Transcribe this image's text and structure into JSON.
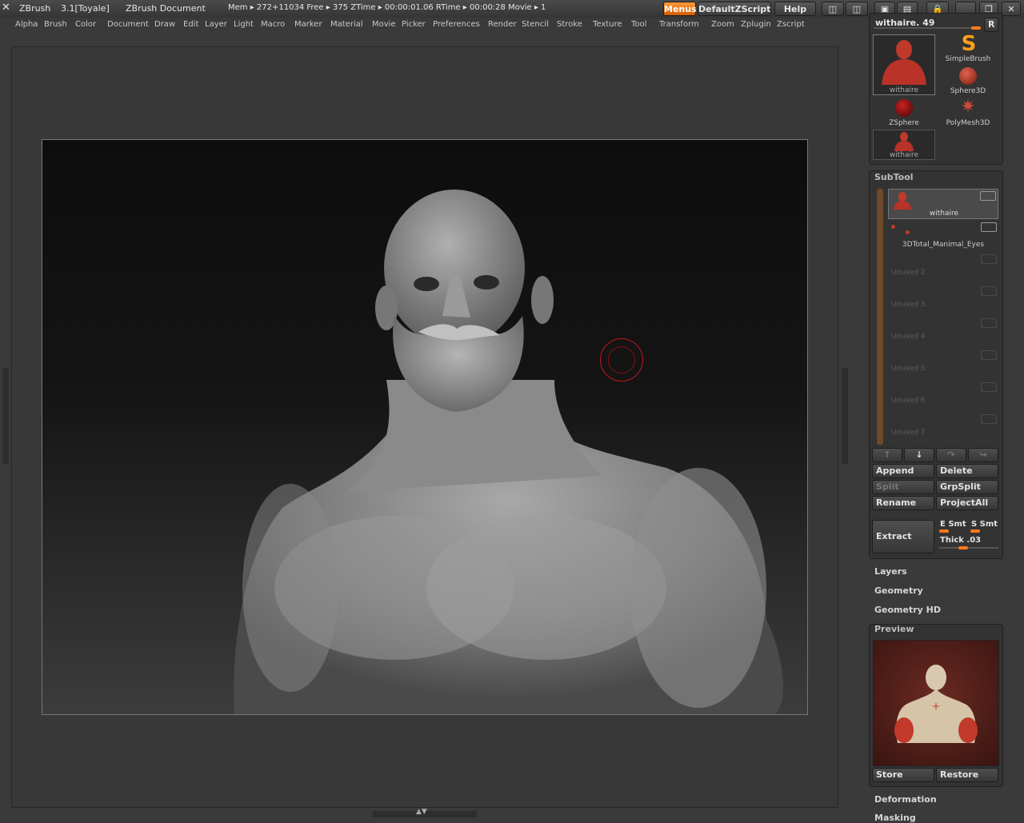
{
  "titlebar": {
    "app": "ZBrush",
    "version": "3.1[Toyale]",
    "document": "ZBrush Document",
    "stats": "Mem ▸ 272+11034  Free ▸ 375  ZTime ▸ 00:00:01.06  RTime ▸ 00:00:28  Movie ▸ 1",
    "menus_btn": "Menus",
    "script_btn": "DefaultZScript",
    "help_btn": "Help"
  },
  "menu": [
    "Alpha",
    "Brush",
    "Color",
    "Document",
    "Draw",
    "Edit",
    "Layer",
    "Light",
    "Macro",
    "Marker",
    "Material",
    "Movie",
    "Picker",
    "Preferences",
    "Render",
    "Stencil",
    "Stroke",
    "Texture",
    "Tool",
    "Transform",
    "Zoom",
    "Zplugin",
    "Zscript"
  ],
  "tool": {
    "current": "withaire. 49",
    "r_button": "R",
    "items": [
      {
        "label": "withaire"
      },
      {
        "label": "SimpleBrush"
      },
      {
        "label": "Sphere3D"
      },
      {
        "label": "ZSphere"
      },
      {
        "label": "PolyMesh3D"
      },
      {
        "label": "withaire"
      }
    ]
  },
  "subtool": {
    "title": "SubTool",
    "rows": [
      {
        "label": "withaire"
      },
      {
        "label": "3DTotal_Manimal_Eyes"
      },
      {
        "label": "Unused  2"
      },
      {
        "label": "Unused  3"
      },
      {
        "label": "Unused  4"
      },
      {
        "label": "Unused  5"
      },
      {
        "label": "Unused  6"
      },
      {
        "label": "Unused  7"
      }
    ],
    "append": "Append",
    "delete": "Delete",
    "split": "Split",
    "grpsplit": "GrpSplit",
    "rename": "Rename",
    "projectall": "ProjectAll",
    "extract": "Extract",
    "esmt": "E  Smt",
    "ssmt": "S  Smt",
    "thick": "Thick .03"
  },
  "sections": {
    "layers": "Layers",
    "geometry": "Geometry",
    "geometry_hd": "Geometry HD",
    "preview": "Preview",
    "store": "Store",
    "restore": "Restore",
    "deformation": "Deformation",
    "masking": "Masking"
  },
  "colors": {
    "accent": "#ff7a1a",
    "brush_cursor": "#c01818"
  }
}
